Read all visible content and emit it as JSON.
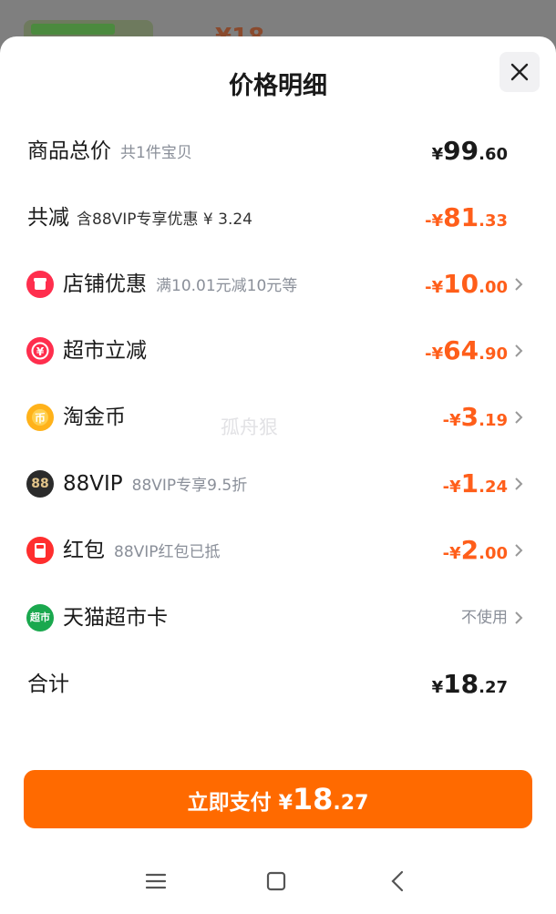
{
  "background": {
    "price_fragment": "¥18"
  },
  "sheet": {
    "title": "价格明细",
    "close_icon": "close-icon",
    "watermark": "孤舟狠"
  },
  "rows": {
    "total": {
      "label": "商品总价",
      "sub": "共1件宝贝",
      "cur": "¥",
      "int": "99",
      "dec": ".60"
    },
    "reduction": {
      "label": "共减",
      "sub": "含88VIP专享优惠 ¥ 3.24",
      "cur": "-¥",
      "int": "81",
      "dec": ".33"
    },
    "shop": {
      "label": "店铺优惠",
      "sub": "满10.01元减10元等",
      "cur": "-¥",
      "int": "10",
      "dec": ".00",
      "icon": "shop-icon"
    },
    "market": {
      "label": "超市立减",
      "sub": "",
      "cur": "-¥",
      "int": "64",
      "dec": ".90",
      "icon": "yen-coupon-icon"
    },
    "coin": {
      "label": "淘金币",
      "sub": "",
      "cur": "-¥",
      "int": "3",
      "dec": ".19",
      "icon": "gold-coin-icon"
    },
    "vip": {
      "label": "88VIP",
      "sub": "88VIP专享9.5折",
      "cur": "-¥",
      "int": "1",
      "dec": ".24",
      "icon_text": "88"
    },
    "redpacket": {
      "label": "红包",
      "sub": "88VIP红包已抵",
      "cur": "-¥",
      "int": "2",
      "dec": ".00",
      "icon": "red-packet-icon"
    },
    "card": {
      "label": "天猫超市卡",
      "right": "不使用",
      "icon_text": "超市"
    },
    "sum": {
      "label": "合计",
      "cur": "¥",
      "int": "18",
      "dec": ".27"
    }
  },
  "pay_button": {
    "label": "立即支付",
    "cur": "¥",
    "int": "18",
    "dec": ".27"
  },
  "colors": {
    "accent": "#ff6a00",
    "discount": "#ff5e1a",
    "text": "#1a1a1a",
    "muted": "#8a8f99"
  },
  "navbar": {
    "icons": [
      "menu-icon",
      "home-square-icon",
      "back-chevron-icon"
    ]
  }
}
